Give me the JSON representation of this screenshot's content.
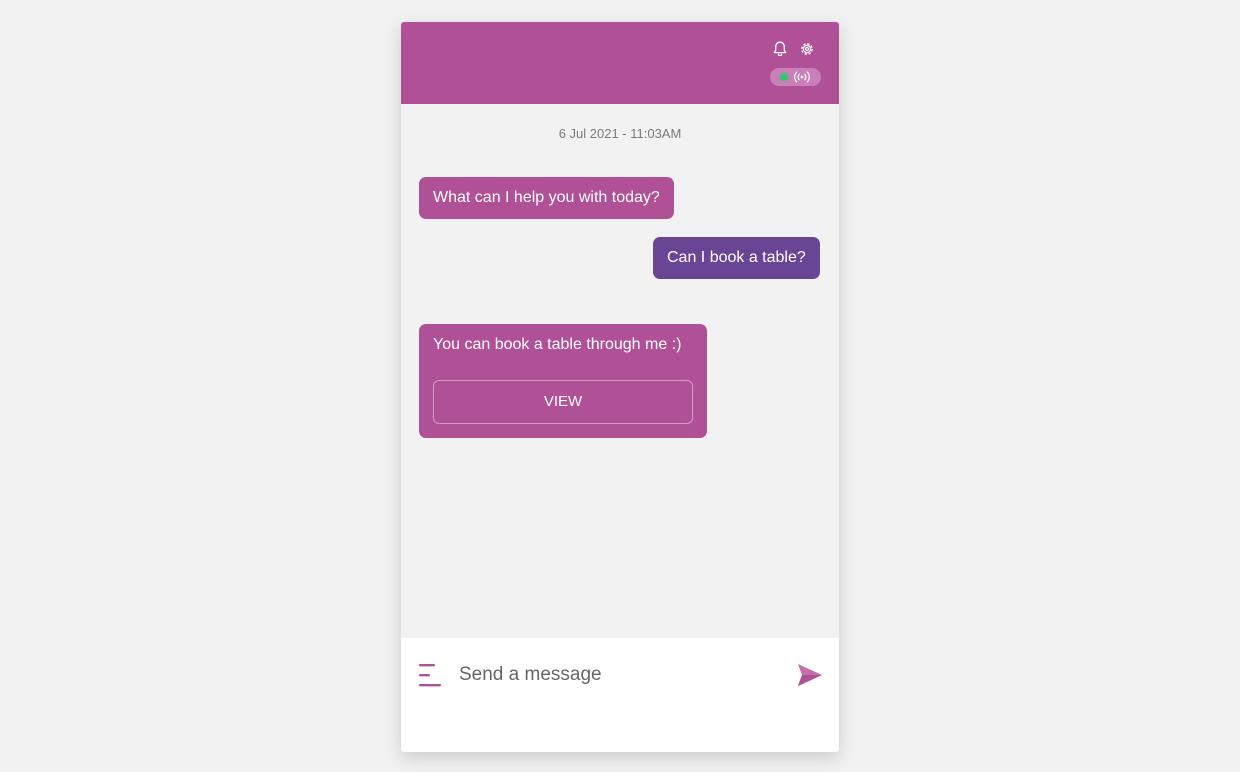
{
  "header": {
    "bell_icon": "bell-icon",
    "settings_icon": "gear-icon",
    "status": {
      "online_color": "#2ecc71",
      "icon": "broadcast-icon"
    },
    "color": "#b05096"
  },
  "chat": {
    "timestamp": "6 Jul 2021 - 11:03AM",
    "messages": [
      {
        "sender": "bot",
        "text": "What can I help you with today?"
      },
      {
        "sender": "user",
        "text": "Can I book a table?"
      },
      {
        "sender": "bot",
        "text": "You can book a table through me :)",
        "button_label": "VIEW"
      }
    ],
    "bot_color": "#b05096",
    "user_color": "#6a4596"
  },
  "composer": {
    "placeholder": "Send a message",
    "menu_icon": "menu-icon",
    "send_icon": "send-icon"
  }
}
